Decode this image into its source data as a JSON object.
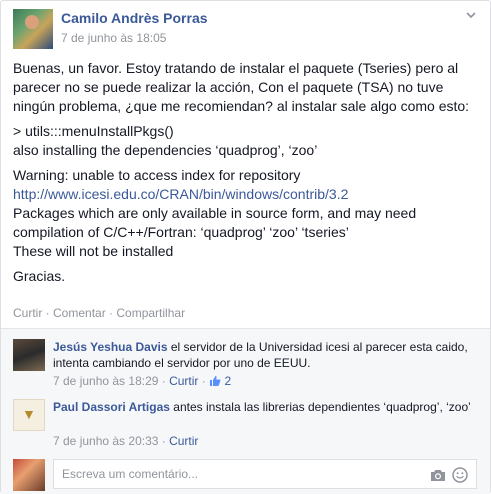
{
  "post": {
    "author": "Camilo Andrès Porras",
    "timestamp": "7 de junho às 18:05",
    "paragraphs": [
      "Buenas, un favor. Estoy tratando de instalar el paquete (Tseries) pero al parecer no se puede realizar la acción, Con el paquete (TSA) no tuve ningún problema, ¿que me recomiendan? al instalar sale algo como esto:"
    ],
    "code_line1": "> utils:::menuInstallPkgs()",
    "code_line2": "also installing the dependencies ‘quadprog’, ‘zoo’",
    "warning_prefix": "Warning: unable to access index for repository ",
    "warning_link": "http://www.icesi.edu.co/CRAN/bin/windows/contrib/3.2",
    "packages_line": "Packages which are only available in source form, and may need compilation of C/C++/Fortran: ‘quadprog’ ‘zoo’ ‘tseries’",
    "not_installed": "These will not be installed",
    "thanks": "Gracias."
  },
  "actions": {
    "like": "Curtir",
    "sep1": " · ",
    "comment": "Comentar",
    "sep2": " · ",
    "share": "Compartilhar"
  },
  "comments": [
    {
      "author": "Jesús Yeshua Davis",
      "text": " el servidor de la Universidad icesi al parecer esta caido, intenta cambiando el servidor por uno de EEUU.",
      "time": "7 de junho às 18:29",
      "sep": " · ",
      "like": "Curtir",
      "sep2": " · ",
      "likes": "2"
    },
    {
      "author": "Paul Dassori Artigas",
      "text": " antes instala las librerias dependientes ‘quadprog’, ‘zoo’",
      "time": "7 de junho às 20:33",
      "sep": " · ",
      "like": "Curtir"
    }
  ],
  "composer": {
    "placeholder": "Escreva um comentário..."
  },
  "colors": {
    "link": "#3b5998",
    "meta": "#90949c",
    "like_icon": "#5890ff"
  }
}
